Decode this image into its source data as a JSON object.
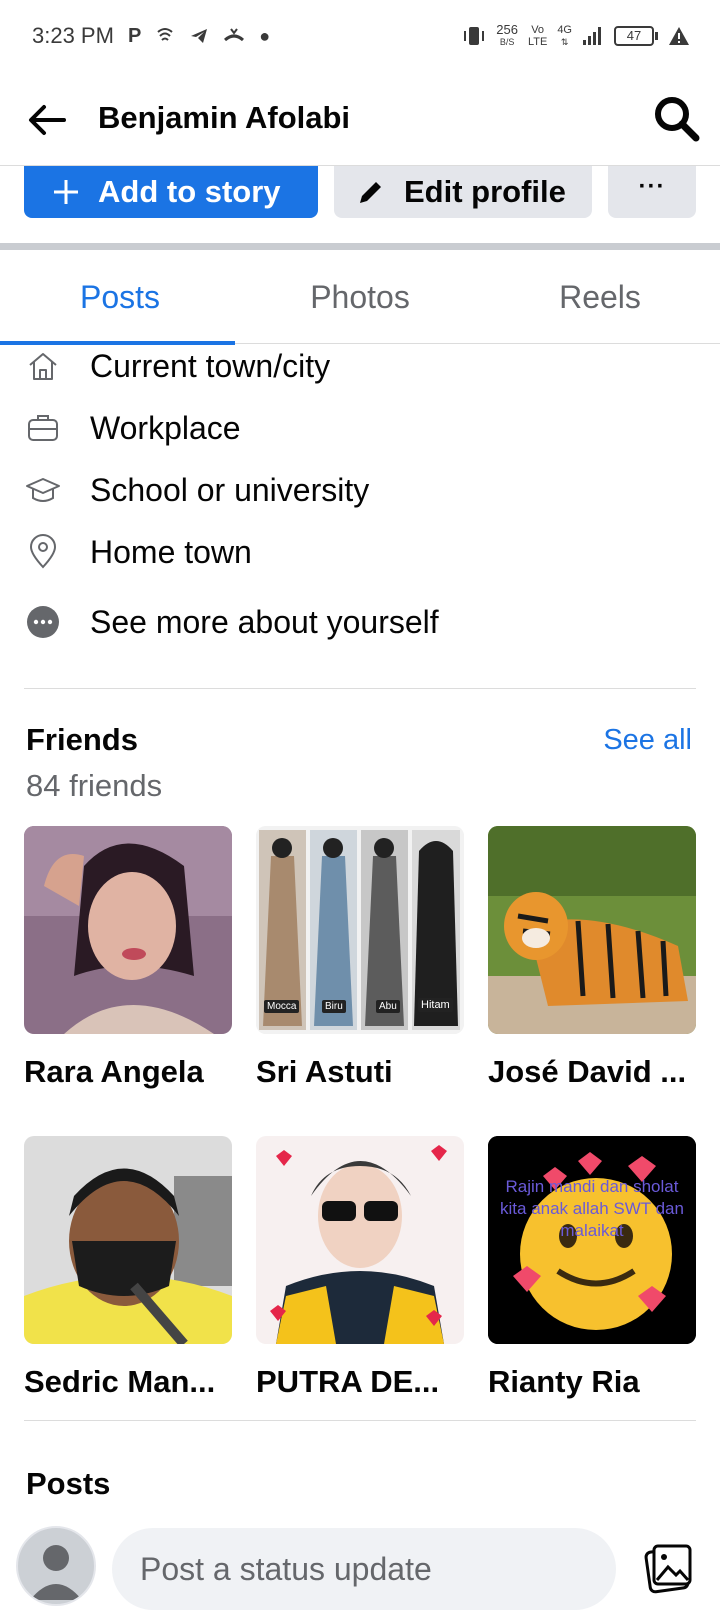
{
  "status_bar": {
    "time": "3:23 PM",
    "net_speed_value": "256",
    "net_speed_unit": "B/S",
    "volte_top": "Vo",
    "volte_bottom": "LTE",
    "network": "4G",
    "battery": "47",
    "battery_level": 0.47
  },
  "header": {
    "title": "Benjamin Afolabi"
  },
  "actions": {
    "add_story": "Add to story",
    "edit_profile": "Edit profile",
    "more": "···"
  },
  "tabs": [
    {
      "label": "Posts",
      "active": true
    },
    {
      "label": "Photos",
      "active": false
    },
    {
      "label": "Reels",
      "active": false
    }
  ],
  "about": [
    {
      "icon": "house-icon",
      "label": "Current town/city"
    },
    {
      "icon": "briefcase-icon",
      "label": "Workplace"
    },
    {
      "icon": "graduation-cap-icon",
      "label": "School or university"
    },
    {
      "icon": "location-pin-icon",
      "label": "Home town"
    },
    {
      "icon": "more-dots-icon",
      "label": "See more about yourself"
    }
  ],
  "friends": {
    "title": "Friends",
    "see_all": "See all",
    "count": "84 friends",
    "items": [
      {
        "name": "Rara Angela"
      },
      {
        "name": "Sri Astuti",
        "photo_labels": [
          "Mocca",
          "Biru",
          "Abu",
          "Hitam"
        ]
      },
      {
        "name": "José David ..."
      },
      {
        "name": "Sedric Man..."
      },
      {
        "name": "PUTRA  DE..."
      },
      {
        "name": "Rianty Ria",
        "photo_caption": "Rajin mandi dan sholat kita anak allah SWT dan malaikat"
      }
    ]
  },
  "posts": {
    "title": "Posts",
    "status_placeholder": "Post a status update"
  },
  "colors": {
    "accent": "#1b74e4",
    "secondary_button": "#e4e6eb",
    "muted_text": "#65676b"
  }
}
